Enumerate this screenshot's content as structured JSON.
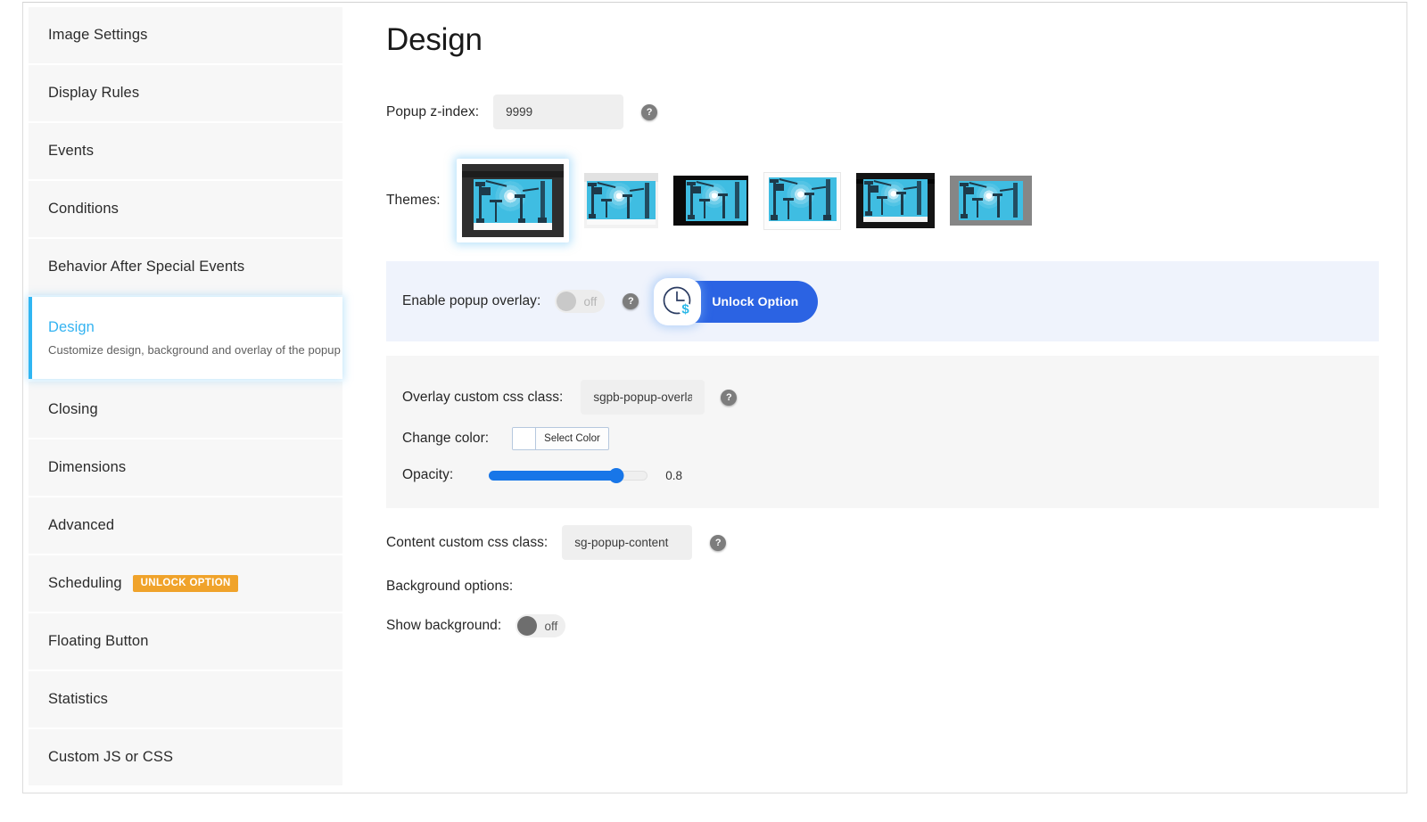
{
  "sidebar": {
    "items": [
      {
        "label": "Image Settings"
      },
      {
        "label": "Display Rules"
      },
      {
        "label": "Events"
      },
      {
        "label": "Conditions"
      },
      {
        "label": "Behavior After Special Events"
      },
      {
        "label": "Design",
        "sublabel": "Customize design, background and overlay of the popup",
        "active": true
      },
      {
        "label": "Closing"
      },
      {
        "label": "Dimensions"
      },
      {
        "label": "Advanced"
      },
      {
        "label": "Scheduling",
        "badge": "UNLOCK OPTION"
      },
      {
        "label": "Floating Button"
      },
      {
        "label": "Statistics"
      },
      {
        "label": "Custom JS or CSS"
      }
    ]
  },
  "main": {
    "title": "Design",
    "zindex": {
      "label": "Popup z-index:",
      "value": "9999",
      "help": "?"
    },
    "themes": {
      "label": "Themes:",
      "selected_index": 0,
      "items": [
        {
          "name": "theme-dark-frame"
        },
        {
          "name": "theme-light-bar"
        },
        {
          "name": "theme-black-solid"
        },
        {
          "name": "theme-white-frame"
        },
        {
          "name": "theme-black-frame"
        },
        {
          "name": "theme-gray-frame"
        }
      ]
    },
    "overlay_enable": {
      "label": "Enable popup overlay:",
      "toggle_state": "off",
      "help": "?",
      "unlock_label": "Unlock Option",
      "unlock_icon": "clock-dollar-icon",
      "accent": "#2b63e3"
    },
    "overlay_settings": {
      "css_class": {
        "label": "Overlay custom css class:",
        "value": "sgpb-popup-overlay",
        "help": "?"
      },
      "change_color": {
        "label": "Change color:",
        "button_label": "Select Color",
        "swatch_color": "#ffffff"
      },
      "opacity": {
        "label": "Opacity:",
        "value": "0.8",
        "percent": 80,
        "accent": "#1876e8"
      }
    },
    "content_css": {
      "label": "Content custom css class:",
      "value": "sg-popup-content",
      "help": "?"
    },
    "background_options": {
      "label": "Background options:",
      "show_background": {
        "label": "Show background:",
        "toggle_state": "off"
      }
    }
  },
  "colors": {
    "active_accent": "#30b6f2",
    "badge_orange": "#f0a32b",
    "unlock_blue": "#2b63e3",
    "slider_blue": "#1876e8"
  }
}
